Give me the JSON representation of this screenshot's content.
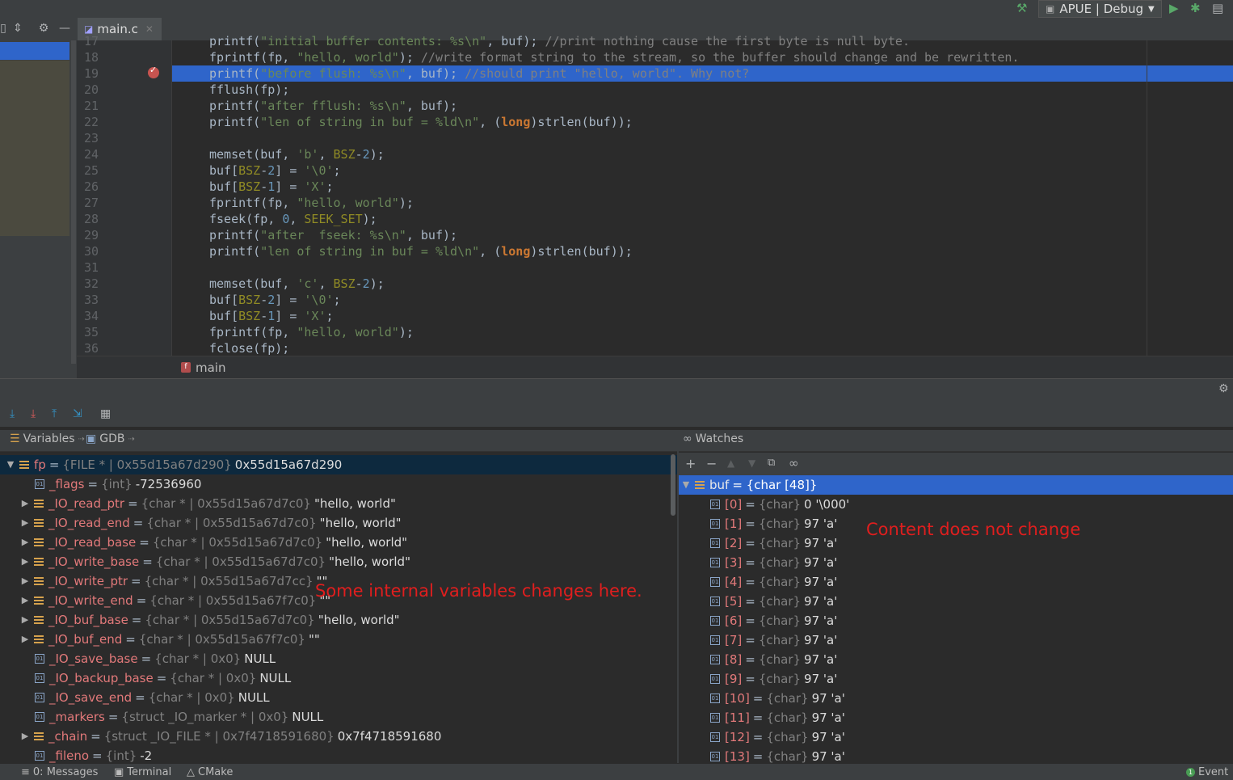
{
  "toolbar": {
    "run_config": "APUE | Debug"
  },
  "editor": {
    "tab_label": "main.c",
    "breadcrumb": "main",
    "lines": [
      {
        "n": "17",
        "html": "<span>printf(</span><span class=\"str\">\"initial buffer contents: %s\\n\"</span><span>, buf); </span><span class=\"cm\">//print nothing cause the first byte is null byte.</span>"
      },
      {
        "n": "18",
        "html": "<span>fprintf(fp, </span><span class=\"str\">\"hello, world\"</span><span>); </span><span class=\"cm\">//write format string to the stream, so the buffer should change and be rewritten.</span>"
      },
      {
        "n": "19",
        "html": "<span>printf(</span><span class=\"str\">\"before flush: %s\\n\"</span><span>, buf); </span><span class=\"cm\">//should print \"hello, world\". Why not?</span>"
      },
      {
        "n": "20",
        "html": "<span>fflush(fp);</span>"
      },
      {
        "n": "21",
        "html": "<span>printf(</span><span class=\"str\">\"after fflush: %s\\n\"</span><span>, buf);</span>"
      },
      {
        "n": "22",
        "html": "<span>printf(</span><span class=\"str\">\"len of string in buf = %ld\\n\"</span><span>, (</span><span class=\"kw\">long</span><span>)strlen(buf));</span>"
      },
      {
        "n": "23",
        "html": ""
      },
      {
        "n": "24",
        "html": "<span>memset(buf, </span><span class=\"str\">'b'</span><span>, </span><span class=\"mac\">BSZ</span><span>-</span><span class=\"num\">2</span><span>);</span>"
      },
      {
        "n": "25",
        "html": "<span>buf[</span><span class=\"mac\">BSZ</span><span>-</span><span class=\"num\">2</span><span>] = </span><span class=\"str\">'\\0'</span><span>;</span>"
      },
      {
        "n": "26",
        "html": "<span>buf[</span><span class=\"mac\">BSZ</span><span>-</span><span class=\"num\">1</span><span>] = </span><span class=\"str\">'X'</span><span>;</span>"
      },
      {
        "n": "27",
        "html": "<span>fprintf(fp, </span><span class=\"str\">\"hello, world\"</span><span>);</span>"
      },
      {
        "n": "28",
        "html": "<span>fseek(fp, </span><span class=\"num\">0</span><span>, </span><span class=\"mac\">SEEK_SET</span><span>);</span>"
      },
      {
        "n": "29",
        "html": "<span>printf(</span><span class=\"str\">\"after  fseek: %s\\n\"</span><span>, buf);</span>"
      },
      {
        "n": "30",
        "html": "<span>printf(</span><span class=\"str\">\"len of string in buf = %ld\\n\"</span><span>, (</span><span class=\"kw\">long</span><span>)strlen(buf));</span>"
      },
      {
        "n": "31",
        "html": ""
      },
      {
        "n": "32",
        "html": "<span>memset(buf, </span><span class=\"str\">'c'</span><span>, </span><span class=\"mac\">BSZ</span><span>-</span><span class=\"num\">2</span><span>);</span>"
      },
      {
        "n": "33",
        "html": "<span>buf[</span><span class=\"mac\">BSZ</span><span>-</span><span class=\"num\">2</span><span>] = </span><span class=\"str\">'\\0'</span><span>;</span>"
      },
      {
        "n": "34",
        "html": "<span>buf[</span><span class=\"mac\">BSZ</span><span>-</span><span class=\"num\">1</span><span>] = </span><span class=\"str\">'X'</span><span>;</span>"
      },
      {
        "n": "35",
        "html": "<span>fprintf(fp, </span><span class=\"str\">\"hello, world\"</span><span>);</span>"
      },
      {
        "n": "36",
        "html": "<span>fclose(fp);</span>"
      }
    ],
    "current_line": "19"
  },
  "debug": {
    "variables_tab": "Variables",
    "gdb_tab": "GDB",
    "watches_tab": "Watches",
    "variables": [
      {
        "name": "fp",
        "type": "{FILE * | 0x55d15a67d290}",
        "value": "0x55d15a67d290",
        "kind": "list",
        "arrow": "open",
        "indent": 0,
        "selected": true
      },
      {
        "name": "_flags",
        "type": "{int}",
        "value": "-72536960",
        "kind": "prim",
        "arrow": "none",
        "indent": 1
      },
      {
        "name": "_IO_read_ptr",
        "type": "{char * | 0x55d15a67d7c0}",
        "value": "\"hello, world\"",
        "kind": "list",
        "arrow": "closed",
        "indent": 1
      },
      {
        "name": "_IO_read_end",
        "type": "{char * | 0x55d15a67d7c0}",
        "value": "\"hello, world\"",
        "kind": "list",
        "arrow": "closed",
        "indent": 1
      },
      {
        "name": "_IO_read_base",
        "type": "{char * | 0x55d15a67d7c0}",
        "value": "\"hello, world\"",
        "kind": "list",
        "arrow": "closed",
        "indent": 1
      },
      {
        "name": "_IO_write_base",
        "type": "{char * | 0x55d15a67d7c0}",
        "value": "\"hello, world\"",
        "kind": "list",
        "arrow": "closed",
        "indent": 1
      },
      {
        "name": "_IO_write_ptr",
        "type": "{char * | 0x55d15a67d7cc}",
        "value": "\"\"",
        "kind": "list",
        "arrow": "closed",
        "indent": 1
      },
      {
        "name": "_IO_write_end",
        "type": "{char * | 0x55d15a67f7c0}",
        "value": "\"\"",
        "kind": "list",
        "arrow": "closed",
        "indent": 1
      },
      {
        "name": "_IO_buf_base",
        "type": "{char * | 0x55d15a67d7c0}",
        "value": "\"hello, world\"",
        "kind": "list",
        "arrow": "closed",
        "indent": 1
      },
      {
        "name": "_IO_buf_end",
        "type": "{char * | 0x55d15a67f7c0}",
        "value": "\"\"",
        "kind": "list",
        "arrow": "closed",
        "indent": 1
      },
      {
        "name": "_IO_save_base",
        "type": "{char * | 0x0}",
        "value": "NULL",
        "kind": "prim",
        "arrow": "none",
        "indent": 1
      },
      {
        "name": "_IO_backup_base",
        "type": "{char * | 0x0}",
        "value": "NULL",
        "kind": "prim",
        "arrow": "none",
        "indent": 1
      },
      {
        "name": "_IO_save_end",
        "type": "{char * | 0x0}",
        "value": "NULL",
        "kind": "prim",
        "arrow": "none",
        "indent": 1
      },
      {
        "name": "_markers",
        "type": "{struct _IO_marker * | 0x0}",
        "value": "NULL",
        "kind": "prim",
        "arrow": "none",
        "indent": 1
      },
      {
        "name": "_chain",
        "type": "{struct _IO_FILE * | 0x7f4718591680}",
        "value": "0x7f4718591680",
        "kind": "list",
        "arrow": "closed",
        "indent": 1
      },
      {
        "name": "_fileno",
        "type": "{int}",
        "value": "-2",
        "kind": "prim",
        "arrow": "none",
        "indent": 1
      }
    ],
    "watches": [
      {
        "name": "buf",
        "type": "",
        "value": "= {char [48]}",
        "kind": "list",
        "arrow": "open",
        "indent": 0,
        "selected": true
      },
      {
        "name": "[0]",
        "type": "{char}",
        "value": "0 '\\000'",
        "kind": "prim",
        "arrow": "none",
        "indent": 1
      },
      {
        "name": "[1]",
        "type": "{char}",
        "value": "97 'a'",
        "kind": "prim",
        "arrow": "none",
        "indent": 1
      },
      {
        "name": "[2]",
        "type": "{char}",
        "value": "97 'a'",
        "kind": "prim",
        "arrow": "none",
        "indent": 1
      },
      {
        "name": "[3]",
        "type": "{char}",
        "value": "97 'a'",
        "kind": "prim",
        "arrow": "none",
        "indent": 1
      },
      {
        "name": "[4]",
        "type": "{char}",
        "value": "97 'a'",
        "kind": "prim",
        "arrow": "none",
        "indent": 1
      },
      {
        "name": "[5]",
        "type": "{char}",
        "value": "97 'a'",
        "kind": "prim",
        "arrow": "none",
        "indent": 1
      },
      {
        "name": "[6]",
        "type": "{char}",
        "value": "97 'a'",
        "kind": "prim",
        "arrow": "none",
        "indent": 1
      },
      {
        "name": "[7]",
        "type": "{char}",
        "value": "97 'a'",
        "kind": "prim",
        "arrow": "none",
        "indent": 1
      },
      {
        "name": "[8]",
        "type": "{char}",
        "value": "97 'a'",
        "kind": "prim",
        "arrow": "none",
        "indent": 1
      },
      {
        "name": "[9]",
        "type": "{char}",
        "value": "97 'a'",
        "kind": "prim",
        "arrow": "none",
        "indent": 1
      },
      {
        "name": "[10]",
        "type": "{char}",
        "value": "97 'a'",
        "kind": "prim",
        "arrow": "none",
        "indent": 1
      },
      {
        "name": "[11]",
        "type": "{char}",
        "value": "97 'a'",
        "kind": "prim",
        "arrow": "none",
        "indent": 1
      },
      {
        "name": "[12]",
        "type": "{char}",
        "value": "97 'a'",
        "kind": "prim",
        "arrow": "none",
        "indent": 1
      },
      {
        "name": "[13]",
        "type": "{char}",
        "value": "97 'a'",
        "kind": "prim",
        "arrow": "none",
        "indent": 1
      }
    ]
  },
  "annotations": {
    "vars_note": "Some internal variables changes here.",
    "watch_note": "Content does not change"
  },
  "statusbar": {
    "messages": "0: Messages",
    "terminal": "Terminal",
    "cmake": "CMake",
    "event": "Event"
  },
  "colors": {
    "selection": "#2f65ca",
    "annotation": "#e01e1e"
  }
}
